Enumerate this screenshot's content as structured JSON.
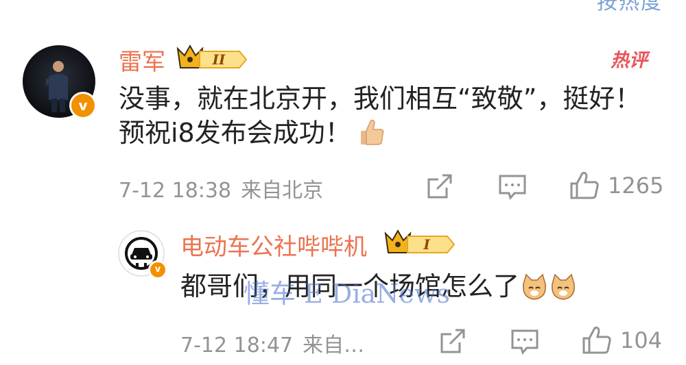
{
  "header": {
    "sort_label": "按热度"
  },
  "comments": [
    {
      "username": "雷军",
      "level": "II",
      "hot_tag": "热评",
      "text_line1": "没事，就在北京开，我们相互“致敬”，挺好！",
      "text_line2": "预祝i8发布会成功！",
      "time": "7-12 18:38",
      "location": "来自北京",
      "likes": "1265"
    },
    {
      "username": "电动车公社哔哔机",
      "level": "I",
      "text": "都哥们，用同一个场馆怎么了",
      "time": "7-12 18:47",
      "location": "来自…",
      "likes": "104"
    }
  ],
  "watermark": "懂车 E DiaNews",
  "colors": {
    "username": "#eb7350",
    "meta": "#939393",
    "badge": "#f29100",
    "hot": "#e8545a"
  }
}
